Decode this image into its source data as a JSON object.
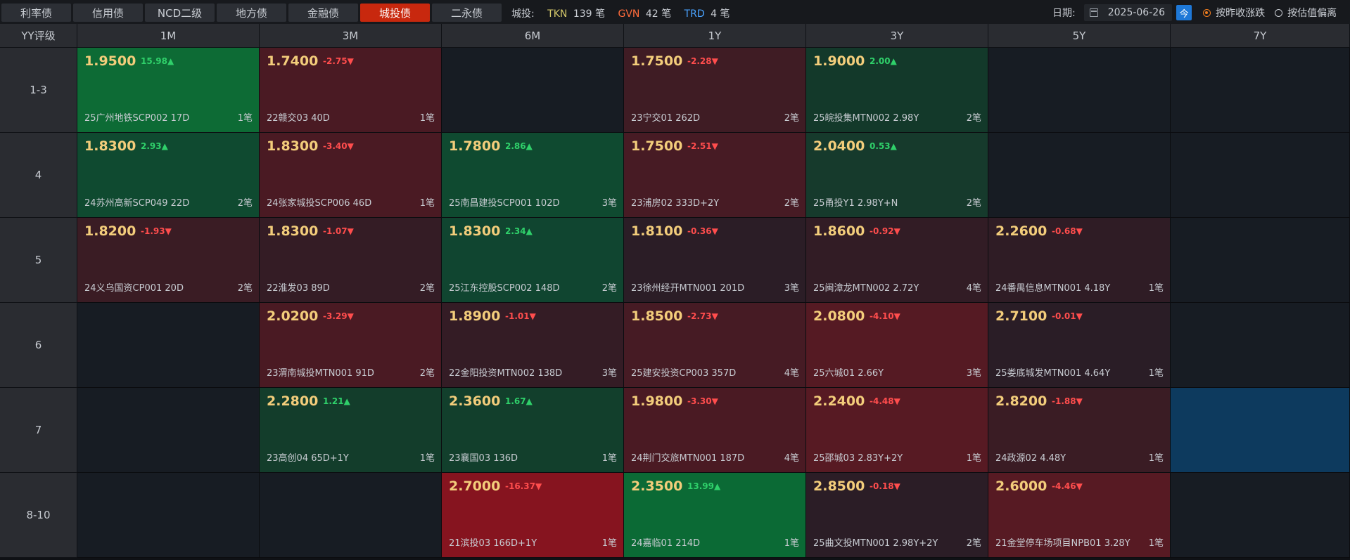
{
  "tabs": [
    "利率债",
    "信用债",
    "NCD二级",
    "地方债",
    "金融债",
    "城投债",
    "二永债"
  ],
  "active_tab": 5,
  "summary": {
    "label": "城投:",
    "items": [
      {
        "name": "TKN",
        "count": "139 笔",
        "color": "#d4c86a"
      },
      {
        "name": "GVN",
        "count": "42 笔",
        "color": "#ff6b3b"
      },
      {
        "name": "TRD",
        "count": "4 笔",
        "color": "#4aa3ff"
      }
    ]
  },
  "date": {
    "label": "日期:",
    "value": "2025-06-26",
    "today": "今"
  },
  "radios": [
    {
      "label": "按昨收涨跌",
      "checked": true
    },
    {
      "label": "按估值偏离",
      "checked": false
    }
  ],
  "grid": {
    "corner": "YY评级",
    "columns": [
      "1M",
      "3M",
      "6M",
      "1Y",
      "3Y",
      "5Y",
      "7Y"
    ],
    "rows": [
      {
        "label": "1-3",
        "cells": [
          {
            "price": "1.9500",
            "change": "15.98▲",
            "dir": "up",
            "name": "25广州地铁SCP002 17D",
            "count": "1笔",
            "bg": "#0d6b35"
          },
          {
            "price": "1.7400",
            "change": "-2.75▼",
            "dir": "down",
            "name": "22赣交03 40D",
            "count": "1笔",
            "bg": "#4a1a23"
          },
          null,
          {
            "price": "1.7500",
            "change": "-2.28▼",
            "dir": "down",
            "name": "23宁交01 262D",
            "count": "2笔",
            "bg": "#3f1c24"
          },
          {
            "price": "1.9000",
            "change": "2.00▲",
            "dir": "up",
            "name": "25皖投集MTN002 2.98Y",
            "count": "2笔",
            "bg": "#13392a"
          },
          null,
          null
        ]
      },
      {
        "label": "4",
        "cells": [
          {
            "price": "1.8300",
            "change": "2.93▲",
            "dir": "up",
            "name": "24苏州高新SCP049 22D",
            "count": "2笔",
            "bg": "#0f4a30"
          },
          {
            "price": "1.8300",
            "change": "-3.40▼",
            "dir": "down",
            "name": "24张家城投SCP006 46D",
            "count": "1笔",
            "bg": "#4a1a23"
          },
          {
            "price": "1.7800",
            "change": "2.86▲",
            "dir": "up",
            "name": "25南昌建投SCP001 102D",
            "count": "3笔",
            "bg": "#0f4a30"
          },
          {
            "price": "1.7500",
            "change": "-2.51▼",
            "dir": "down",
            "name": "23浦房02 333D+2Y",
            "count": "2笔",
            "bg": "#471b24"
          },
          {
            "price": "2.0400",
            "change": "0.53▲",
            "dir": "up",
            "name": "25甬投Y1 2.98Y+N",
            "count": "2笔",
            "bg": "#163a2c"
          },
          null,
          null
        ]
      },
      {
        "label": "5",
        "cells": [
          {
            "price": "1.8200",
            "change": "-1.93▼",
            "dir": "down",
            "name": "24义乌国资CP001 20D",
            "count": "2笔",
            "bg": "#3a1c24"
          },
          {
            "price": "1.8300",
            "change": "-1.07▼",
            "dir": "down",
            "name": "22淮发03 89D",
            "count": "2笔",
            "bg": "#341c25"
          },
          {
            "price": "1.8300",
            "change": "2.34▲",
            "dir": "up",
            "name": "25江东控股SCP002 148D",
            "count": "2笔",
            "bg": "#104530"
          },
          {
            "price": "1.8100",
            "change": "-0.36▼",
            "dir": "down",
            "name": "23徐州经开MTN001 201D",
            "count": "3笔",
            "bg": "#2b1d26"
          },
          {
            "price": "1.8600",
            "change": "-0.92▼",
            "dir": "down",
            "name": "25闽漳龙MTN002 2.72Y",
            "count": "4笔",
            "bg": "#321c25"
          },
          {
            "price": "2.2600",
            "change": "-0.68▼",
            "dir": "down",
            "name": "24番禺信息MTN001 4.18Y",
            "count": "1笔",
            "bg": "#2f1c25"
          },
          null
        ]
      },
      {
        "label": "6",
        "cells": [
          null,
          {
            "price": "2.0200",
            "change": "-3.29▼",
            "dir": "down",
            "name": "23渭南城投MTN001 91D",
            "count": "2笔",
            "bg": "#4a1a23"
          },
          {
            "price": "1.8900",
            "change": "-1.01▼",
            "dir": "down",
            "name": "22金阳投资MTN002 138D",
            "count": "3笔",
            "bg": "#341c25"
          },
          {
            "price": "1.8500",
            "change": "-2.73▼",
            "dir": "down",
            "name": "25建安投资CP003 357D",
            "count": "4笔",
            "bg": "#461b24"
          },
          {
            "price": "2.0800",
            "change": "-4.10▼",
            "dir": "down",
            "name": "25六城01 2.66Y",
            "count": "3笔",
            "bg": "#551a23"
          },
          {
            "price": "2.7100",
            "change": "-0.01▼",
            "dir": "down",
            "name": "25娄底城发MTN001 4.64Y",
            "count": "1笔",
            "bg": "#2a1d26"
          },
          null
        ]
      },
      {
        "label": "7",
        "cells": [
          null,
          {
            "price": "2.2800",
            "change": "1.21▲",
            "dir": "up",
            "name": "23高创04 65D+1Y",
            "count": "1笔",
            "bg": "#133d2b"
          },
          {
            "price": "2.3600",
            "change": "1.67▲",
            "dir": "up",
            "name": "23襄国03 136D",
            "count": "1笔",
            "bg": "#123f2c"
          },
          {
            "price": "1.9800",
            "change": "-3.30▼",
            "dir": "down",
            "name": "24荆门交旅MTN001 187D",
            "count": "4笔",
            "bg": "#4a1a23"
          },
          {
            "price": "2.2400",
            "change": "-4.48▼",
            "dir": "down",
            "name": "25邵城03 2.83Y+2Y",
            "count": "1笔",
            "bg": "#571a23"
          },
          {
            "price": "2.8200",
            "change": "-1.88▼",
            "dir": "down",
            "name": "24政源02 4.48Y",
            "count": "1笔",
            "bg": "#3a1c24"
          },
          {
            "price": "",
            "change": "",
            "dir": "",
            "name": "",
            "count": "",
            "bg": "#0d3a5e"
          }
        ]
      },
      {
        "label": "8-10",
        "cells": [
          null,
          null,
          {
            "price": "2.7000",
            "change": "-16.37▼",
            "dir": "down",
            "name": "21滨投03 166D+1Y",
            "count": "1笔",
            "bg": "#86141f"
          },
          {
            "price": "2.3500",
            "change": "13.99▲",
            "dir": "up",
            "name": "24嘉临01 214D",
            "count": "1笔",
            "bg": "#0b6a35"
          },
          {
            "price": "2.8500",
            "change": "-0.18▼",
            "dir": "down",
            "name": "25曲文投MTN001 2.98Y+2Y",
            "count": "2笔",
            "bg": "#2b1d26"
          },
          {
            "price": "2.6000",
            "change": "-4.46▼",
            "dir": "down",
            "name": "21金堂停车场项目NPB01 3.28Y",
            "count": "1笔",
            "bg": "#571a23"
          },
          null
        ]
      }
    ]
  }
}
